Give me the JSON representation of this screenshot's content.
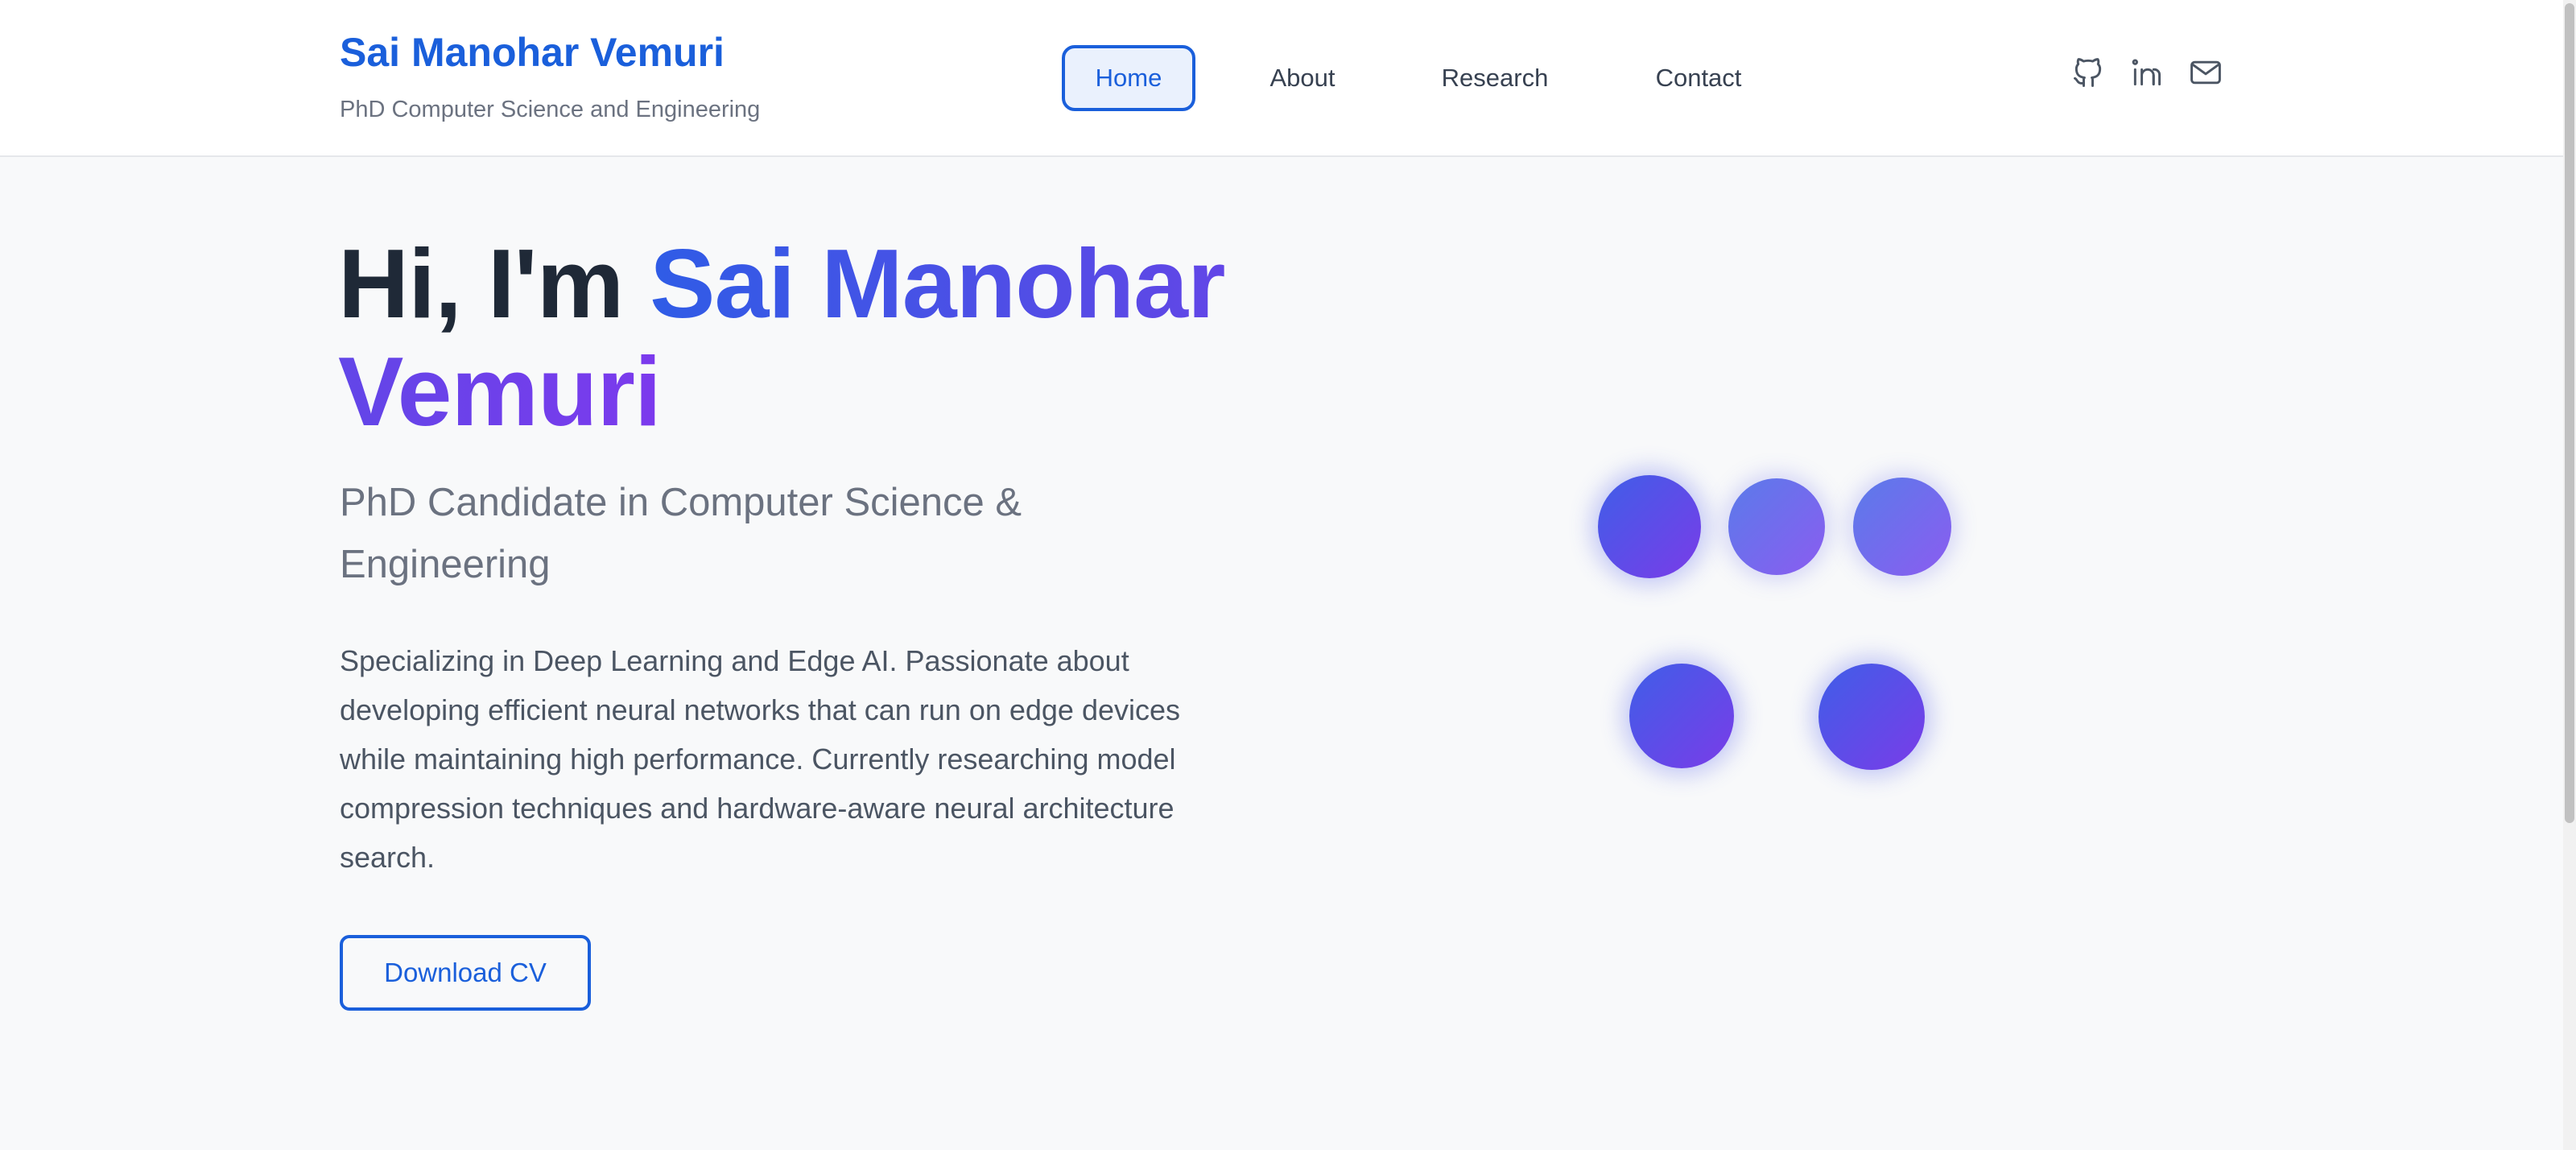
{
  "header": {
    "brand_name": "Sai Manohar Vemuri",
    "brand_tagline": "PhD Computer Science and Engineering",
    "nav": [
      {
        "label": "Home",
        "active": true
      },
      {
        "label": "About",
        "active": false
      },
      {
        "label": "Research",
        "active": false
      },
      {
        "label": "Contact",
        "active": false
      }
    ],
    "social_icons": [
      "github-icon",
      "linkedin-icon",
      "mail-icon"
    ]
  },
  "hero": {
    "title_prefix": "Hi, I'm ",
    "title_highlight": "Sai Manohar Vemuri",
    "subtitle": "PhD Candidate in Computer Science & Engineering",
    "description": "Specializing in Deep Learning and Edge AI. Passionate about developing efficient neural networks that can run on edge devices while maintaining high performance. Currently researching model compression techniques and hardware-aware neural architecture search.",
    "cv_button_label": "Download CV"
  },
  "colors": {
    "accent": "#1a5fdb",
    "gradient_start": "#2f5ce6",
    "gradient_end": "#7c3aed",
    "heading": "#1f2937",
    "muted": "#6b7280",
    "background": "#f8f9fa"
  }
}
